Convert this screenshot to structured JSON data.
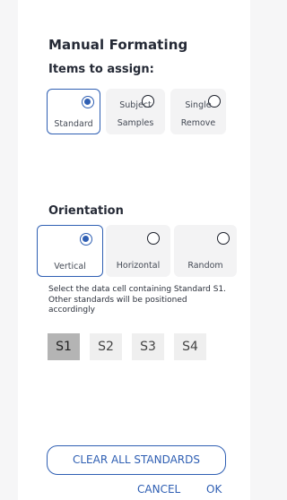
{
  "panel": {
    "title": "Manual Formating",
    "items_heading": "Items to assign:",
    "items": [
      {
        "line1": "",
        "line2": "Standard",
        "selected": true
      },
      {
        "line1": "Subject",
        "line2": "Samples",
        "selected": false
      },
      {
        "line1": "Single",
        "line2": "Remove",
        "selected": false
      }
    ],
    "orientation_heading": "Orientation",
    "orientations": [
      {
        "label": "Vertical",
        "selected": true
      },
      {
        "label": "Horizontal",
        "selected": false
      },
      {
        "label": "Random",
        "selected": false
      }
    ],
    "hint": "Select the data cell containing Standard S1. Other standards will be positioned accordingly",
    "standards": [
      "S1",
      "S2",
      "S3",
      "S4"
    ],
    "active_standard": "S1",
    "clear_label": "CLEAR ALL STANDARDS",
    "cancel_label": "CANCEL",
    "ok_label": "OK"
  },
  "colors": {
    "accent": "#2f5fb3",
    "option_bg": "#f3f3f4",
    "active_standard_bg": "#b4b4b4"
  }
}
